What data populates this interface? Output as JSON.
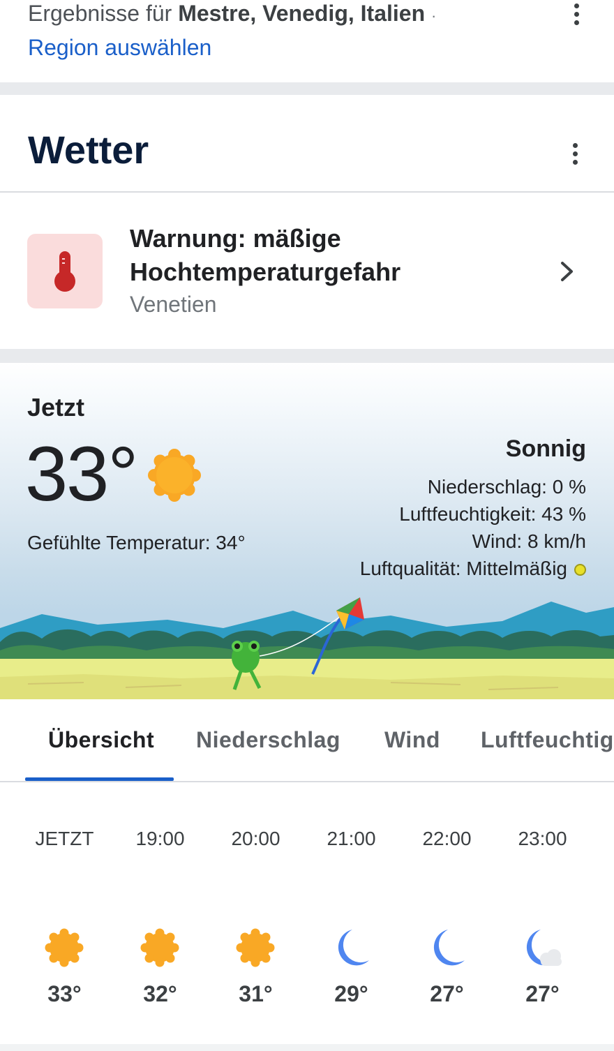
{
  "results": {
    "prefix": "Ergebnisse für ",
    "location": "Mestre, Venedig, Italien",
    "dot": "·",
    "region_link": "Region auswählen"
  },
  "weather_card": {
    "title": "Wetter"
  },
  "warning": {
    "title": "Warnung: mäßige Hochtemperaturgefahr",
    "region": "Venetien",
    "icon": "thermometer-icon"
  },
  "current": {
    "label": "Jetzt",
    "temperature": "33°",
    "feels_like": "Gefühlte Temperatur: 34°",
    "condition": "Sonnig",
    "precipitation": "Niederschlag: 0 %",
    "humidity": "Luftfeuchtigkeit: 43 %",
    "wind": "Wind: 8 km/h",
    "air_quality": "Luftqualität: Mittelmäßig",
    "air_quality_color": "#e8e02a"
  },
  "tabs": [
    {
      "label": "Übersicht",
      "selected": true
    },
    {
      "label": "Niederschlag",
      "selected": false
    },
    {
      "label": "Wind",
      "selected": false
    },
    {
      "label": "Luftfeuchtig",
      "selected": false
    }
  ],
  "hourly": [
    {
      "time": "JETZT",
      "icon": "sun-icon",
      "temp": "33°"
    },
    {
      "time": "19:00",
      "icon": "sun-icon",
      "temp": "32°"
    },
    {
      "time": "20:00",
      "icon": "sun-icon",
      "temp": "31°"
    },
    {
      "time": "21:00",
      "icon": "moon-icon",
      "temp": "29°"
    },
    {
      "time": "22:00",
      "icon": "moon-icon",
      "temp": "27°"
    },
    {
      "time": "23:00",
      "icon": "moon-cloud-icon",
      "temp": "27°"
    }
  ],
  "colors": {
    "accent": "#1a5fc9",
    "sun": "#f9a825",
    "moon": "#4f86f0",
    "warning_bg": "#fadcdc",
    "warning_icon": "#c62828"
  }
}
